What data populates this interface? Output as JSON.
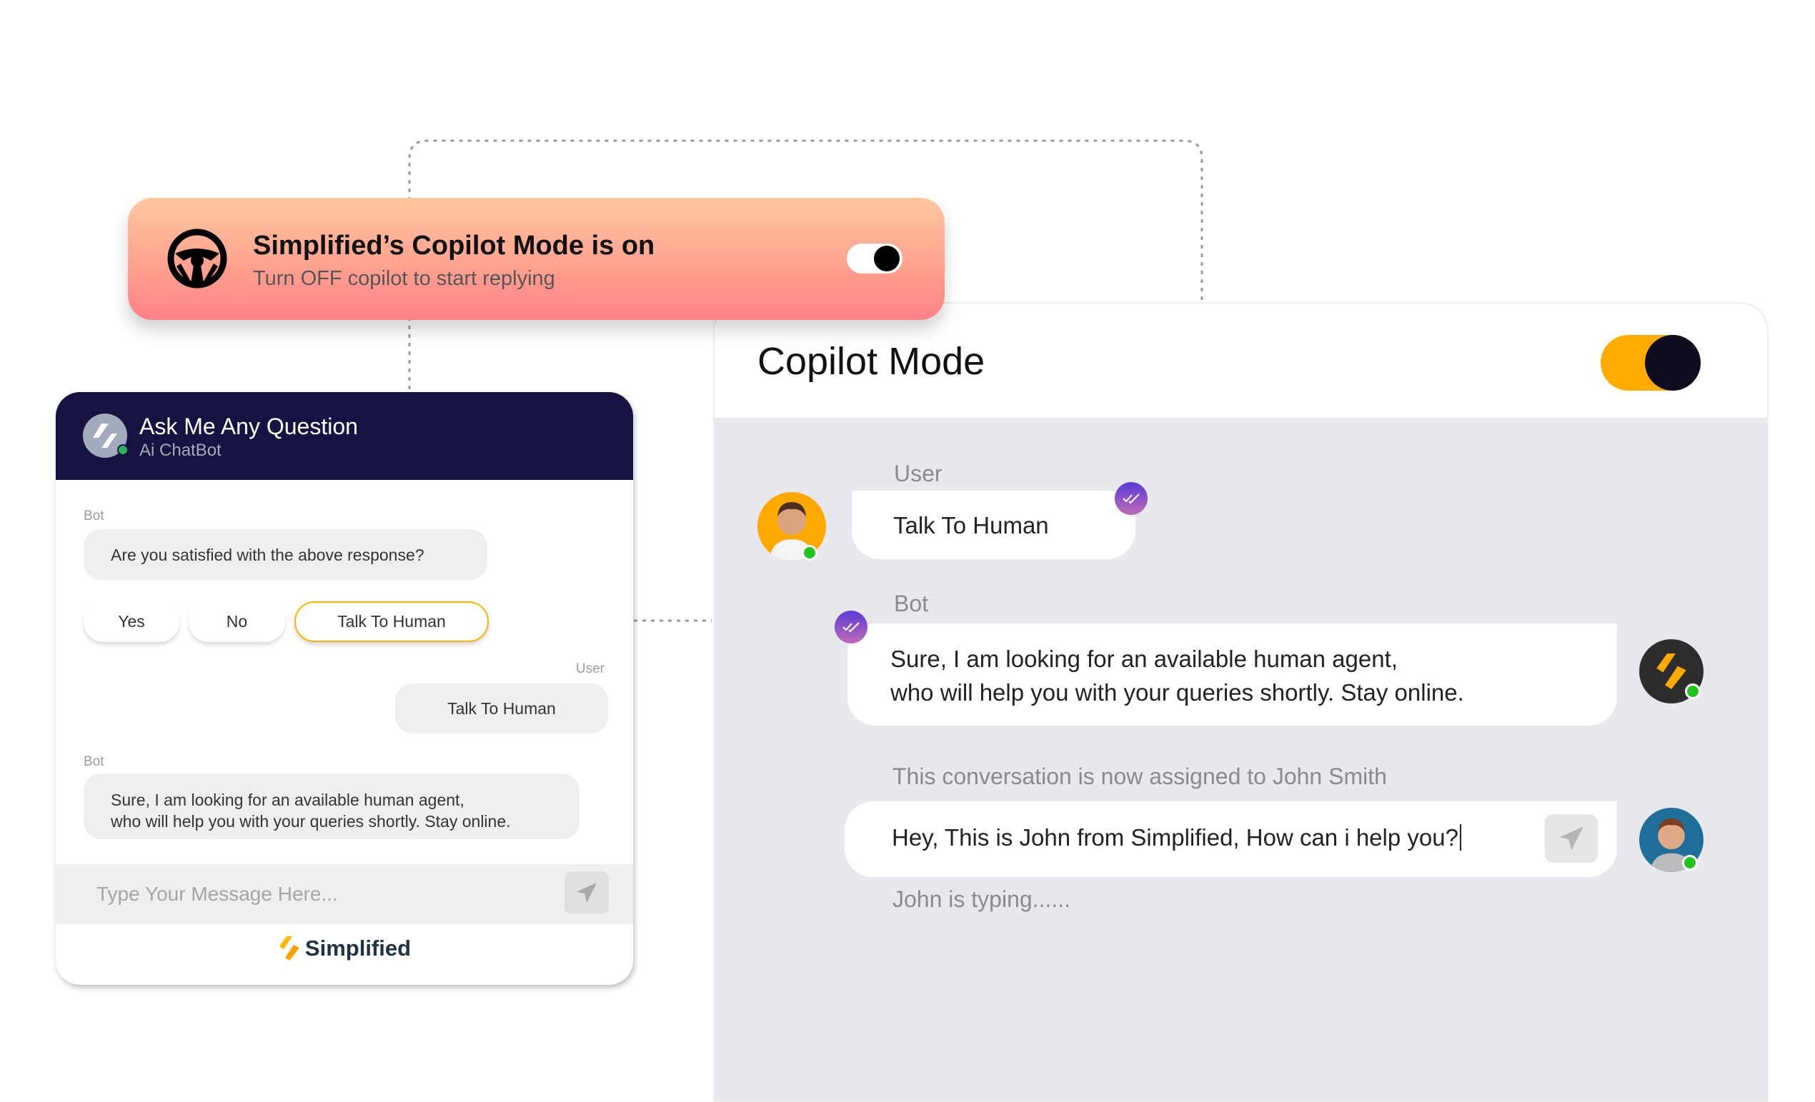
{
  "banner": {
    "title": "Simplified’s Copilot Mode is on",
    "subtitle": "Turn OFF copilot to start replying",
    "toggle_on": true,
    "icon": "steering-wheel-icon"
  },
  "widget": {
    "title": "Ask Me Any Question",
    "subtitle": "Ai ChatBot",
    "messages": [
      {
        "sender": "Bot",
        "text": "Are you satisfied with the above response?"
      },
      {
        "sender": "User",
        "text": "Talk To Human"
      },
      {
        "sender": "Bot",
        "text_line1": "Sure, I am looking for an available human agent,",
        "text_line2": "who will help you with your queries shortly. Stay online."
      }
    ],
    "quick_replies": [
      "Yes",
      "No",
      "Talk To Human"
    ],
    "input_placeholder": "Type Your Message Here...",
    "brand": "Simplified"
  },
  "panel": {
    "title": "Copilot Mode",
    "toggle_on": true,
    "user_label": "User",
    "user_message": "Talk To Human",
    "bot_label": "Bot",
    "bot_line1": "Sure, I am looking for an available human agent,",
    "bot_line2": "who will help you with your queries shortly. Stay online.",
    "assigned_text": "This conversation is now assigned to John Smith",
    "input_value": "Hey, This is John from Simplified, How can i help you?",
    "typing_text": "John is typing......"
  },
  "colors": {
    "accent": "#ffab00",
    "header": "#161241",
    "online": "#22c31f"
  }
}
